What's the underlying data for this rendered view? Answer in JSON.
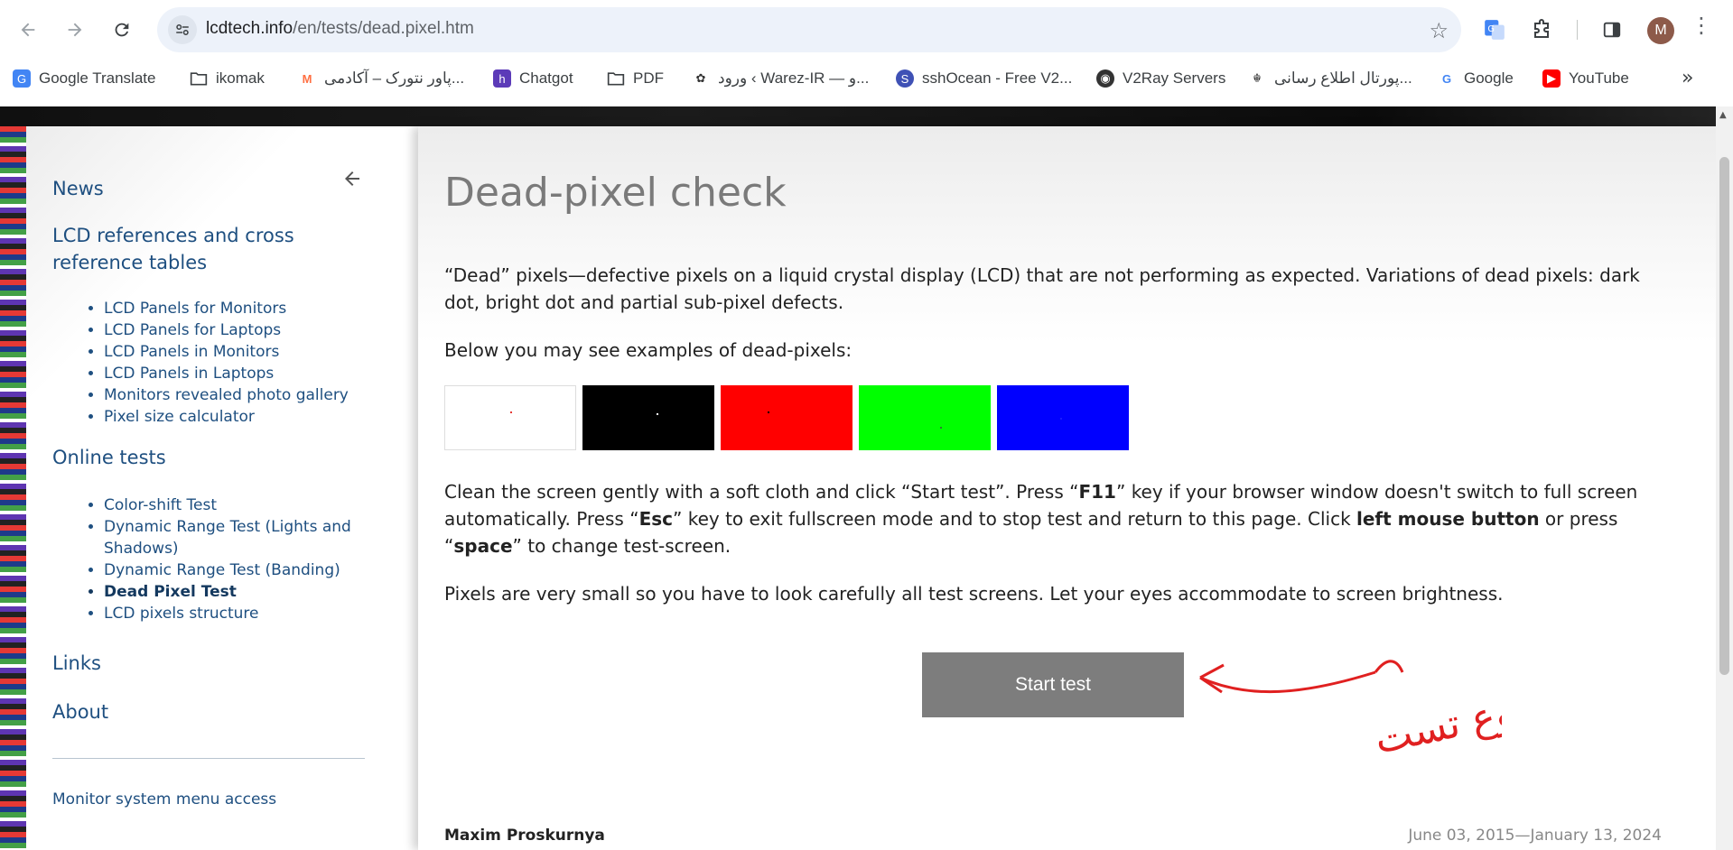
{
  "browser": {
    "url_host": "lcdtech.info",
    "url_path": "/en/tests/dead.pixel.htm",
    "avatar_letter": "M",
    "bookmarks": [
      {
        "label": "Google Translate",
        "icon": "google-translate-icon"
      },
      {
        "label": "ikomak",
        "icon": "folder-icon"
      },
      {
        "label": "پاور نتورک – آکادمی...",
        "icon": "power-network-icon"
      },
      {
        "label": "Chatgot",
        "icon": "chatgot-icon"
      },
      {
        "label": "PDF",
        "icon": "folder-icon"
      },
      {
        "label": "ورود ‹ Warez-IR — و...",
        "icon": "warez-icon"
      },
      {
        "label": "sshOcean - Free V2...",
        "icon": "sshocean-icon"
      },
      {
        "label": "V2Ray Servers",
        "icon": "globe-icon"
      },
      {
        "label": "پورتال اطلاع رسانی...",
        "icon": "emblem-icon"
      },
      {
        "label": "Google",
        "icon": "google-icon"
      },
      {
        "label": "YouTube",
        "icon": "youtube-icon"
      }
    ]
  },
  "sidebar": {
    "news": "News",
    "lcd_refs": "LCD references and cross reference tables",
    "lcd_items": [
      "LCD Panels for Monitors",
      "LCD Panels for Laptops",
      "LCD Panels in Monitors",
      "LCD Panels in Laptops",
      "Monitors revealed photo gallery",
      "Pixel size calculator"
    ],
    "online_tests": "Online tests",
    "test_items": [
      "Color-shift Test",
      "Dynamic Range Test (Lights and Shadows)",
      "Dynamic Range Test (Banding)",
      "Dead Pixel Test",
      "LCD pixels structure"
    ],
    "links": "Links",
    "about": "About",
    "footer": "Monitor system menu access"
  },
  "main": {
    "title": "Dead-pixel check",
    "intro": "“Dead” pixels—defective pixels on a liquid crystal display (LCD) that are not performing as expected. Variations of dead pixels: dark dot, bright dot and partial sub-pixel defects.",
    "examples_label": "Below you may see examples of dead-pixels:",
    "instructions_1": "Clean the screen gently with a soft cloth and click “Start test”. Press “",
    "key_f11": "F11",
    "instructions_2": "” key if your browser window doesn't switch to full screen automatically. Press “",
    "key_esc": "Esc",
    "instructions_3": "” key to exit fullscreen mode and to stop test and return to this page. Click ",
    "left_mouse": "left mouse button",
    "instructions_4": " or press “",
    "key_space": "space",
    "instructions_5": "” to change test-screen.",
    "pixels_note": "Pixels are very small so you have to look carefully all test screens. Let your eyes accommodate to screen brightness.",
    "start_button": "Start test",
    "author": "Maxim Proskurnya",
    "dates": "June 03, 2015—January 13, 2024",
    "swatches": [
      {
        "color": "#ffffff",
        "defect": "#e53935"
      },
      {
        "color": "#000000",
        "defect": "#ffffff"
      },
      {
        "color": "#ff0000",
        "defect": "#000000"
      },
      {
        "color": "#00ff00",
        "defect": "#2e7d32"
      },
      {
        "color": "#0000ff",
        "defect": "#1a1aff"
      }
    ],
    "annotation_text": "شروع تست"
  }
}
